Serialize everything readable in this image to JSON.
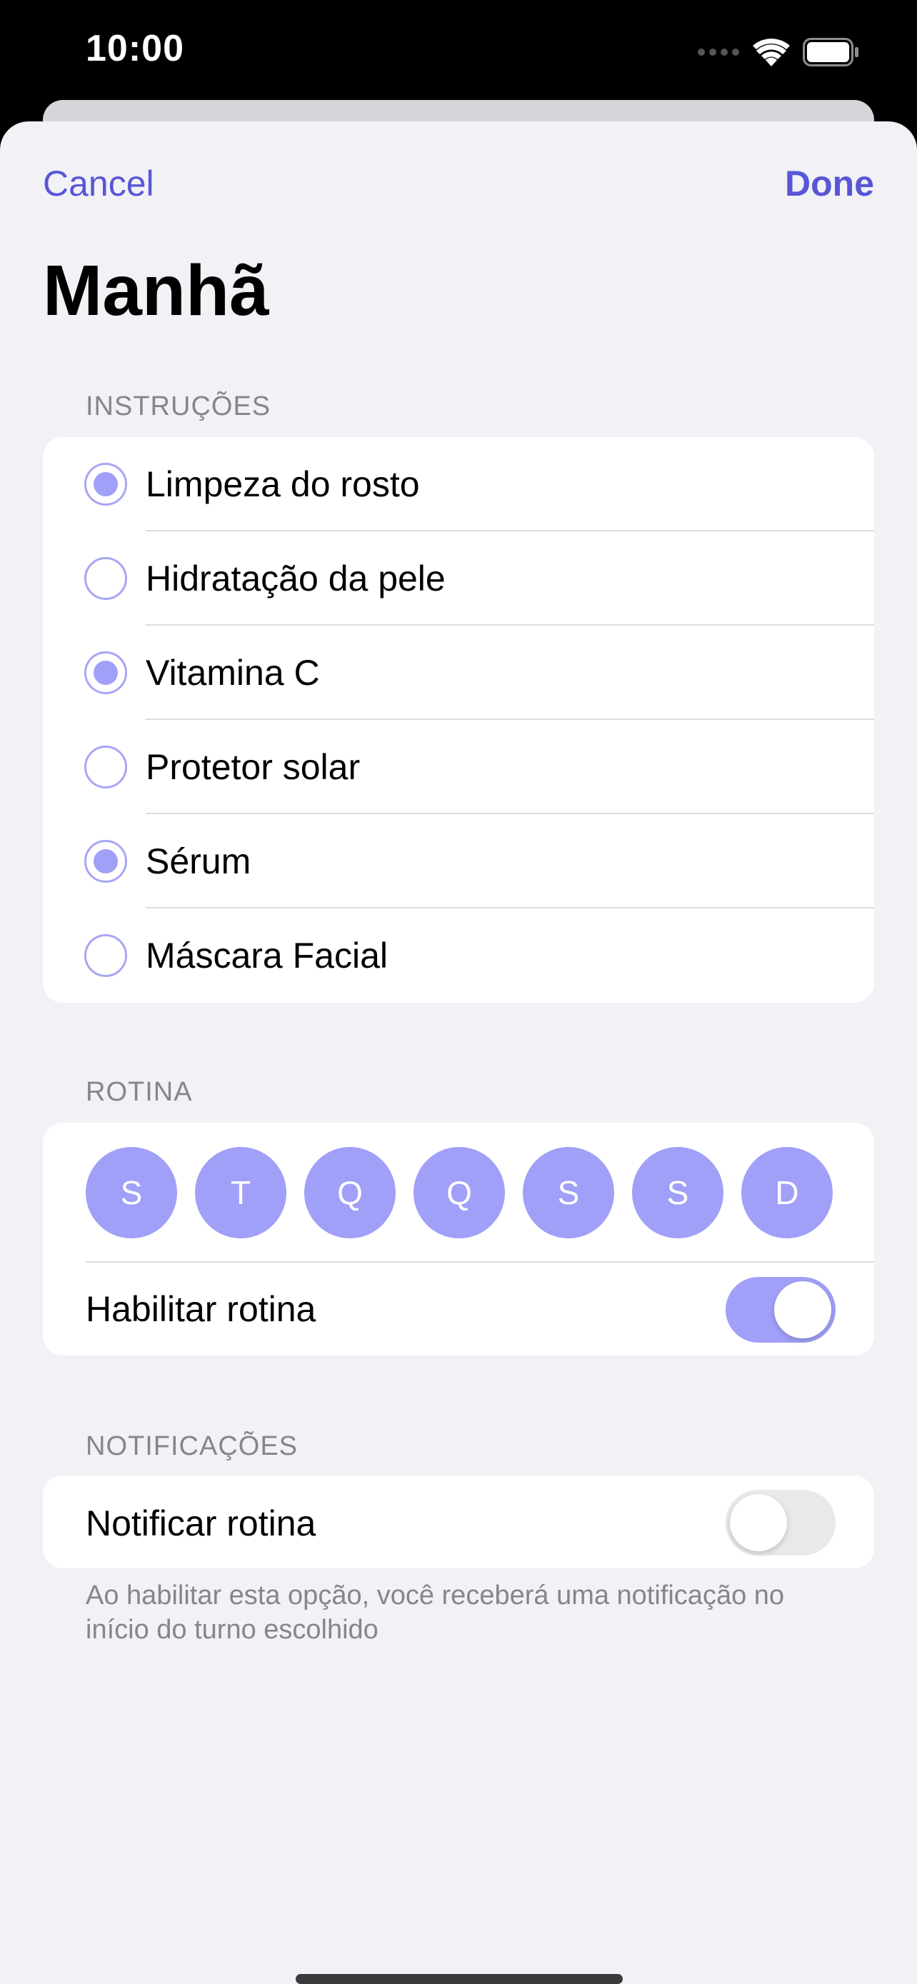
{
  "status_bar": {
    "time": "10:00",
    "icons": [
      "signal-icon",
      "wifi-icon",
      "battery-icon"
    ]
  },
  "nav": {
    "cancel_label": "Cancel",
    "done_label": "Done"
  },
  "title": "Manhã",
  "instructions": {
    "header": "INSTRUÇÕES",
    "items": [
      {
        "label": "Limpeza do rosto",
        "checked": true
      },
      {
        "label": "Hidratação da pele",
        "checked": false
      },
      {
        "label": "Vitamina C",
        "checked": true
      },
      {
        "label": "Protetor solar",
        "checked": false
      },
      {
        "label": "Sérum",
        "checked": true
      },
      {
        "label": "Máscara Facial",
        "checked": false
      }
    ]
  },
  "routine": {
    "header": "ROTINA",
    "days": [
      "S",
      "T",
      "Q",
      "Q",
      "S",
      "S",
      "D"
    ],
    "enable_label": "Habilitar rotina",
    "enabled": true
  },
  "notifications": {
    "header": "NOTIFICAÇÕES",
    "notify_label": "Notificar rotina",
    "notify_enabled": false,
    "footer": "Ao habilitar esta opção, você receberá uma notificação no início do turno escolhido"
  },
  "colors": {
    "accent": "#5856d6",
    "selection": "#a0a0f8",
    "background": "#f2f1f6"
  }
}
